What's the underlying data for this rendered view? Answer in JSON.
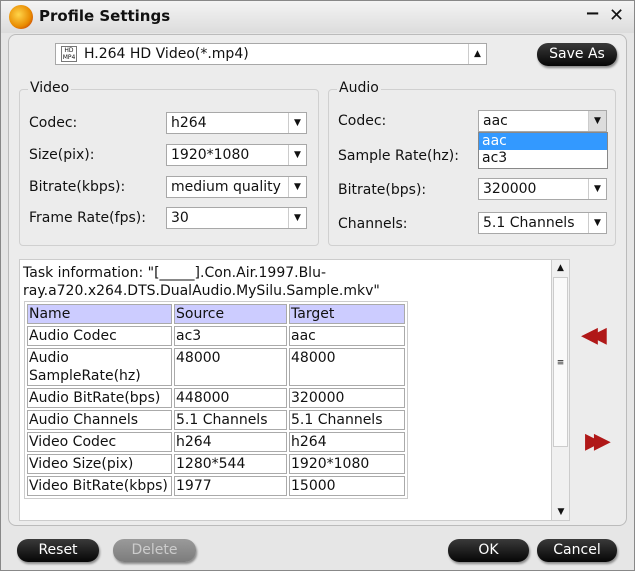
{
  "window": {
    "title": "Profile Settings",
    "minimize": "−",
    "close": "✕"
  },
  "profile": {
    "value": "H.264 HD Video(*.mp4)",
    "icon": "hd-mp4-icon",
    "save_as": "Save As"
  },
  "video": {
    "title": "Video",
    "fields": [
      {
        "label": "Codec:",
        "value": "h264"
      },
      {
        "label": "Size(pix):",
        "value": "1920*1080"
      },
      {
        "label": "Bitrate(kbps):",
        "value": "medium quality"
      },
      {
        "label": "Frame Rate(fps):",
        "value": "30"
      }
    ]
  },
  "audio": {
    "title": "Audio",
    "fields": [
      {
        "label": "Codec:",
        "value": "aac"
      },
      {
        "label": "Sample Rate(hz):",
        "value": ""
      },
      {
        "label": "Bitrate(bps):",
        "value": "320000"
      },
      {
        "label": "Channels:",
        "value": "5.1 Channels"
      }
    ],
    "codec_options": [
      "aac",
      "ac3"
    ],
    "codec_selected": "aac"
  },
  "task": {
    "info": "Task information: \"[_____].Con.Air.1997.Blu-ray.a720.x264.DTS.DualAudio.MySilu.Sample.mkv\"",
    "headers": [
      "Name",
      "Source",
      "Target"
    ],
    "rows": [
      [
        "Audio Codec",
        "ac3",
        "aac"
      ],
      [
        "Audio SampleRate(hz)",
        "48000",
        "48000"
      ],
      [
        "Audio BitRate(bps)",
        "448000",
        "320000"
      ],
      [
        "Audio Channels",
        "5.1 Channels",
        "5.1 Channels"
      ],
      [
        "Video Codec",
        "h264",
        "h264"
      ],
      [
        "Video Size(pix)",
        "1280*544",
        "1920*1080"
      ],
      [
        "Video BitRate(kbps)",
        "1977",
        "15000"
      ]
    ]
  },
  "arrows": {
    "prev": "◀◀",
    "next": "▶▶"
  },
  "buttons": {
    "reset": "Reset",
    "delete": "Delete",
    "ok": "OK",
    "cancel": "Cancel"
  },
  "colors": {
    "header_bg": "#ccccff",
    "highlight": "#3399ff",
    "arrow": "#b01818"
  }
}
